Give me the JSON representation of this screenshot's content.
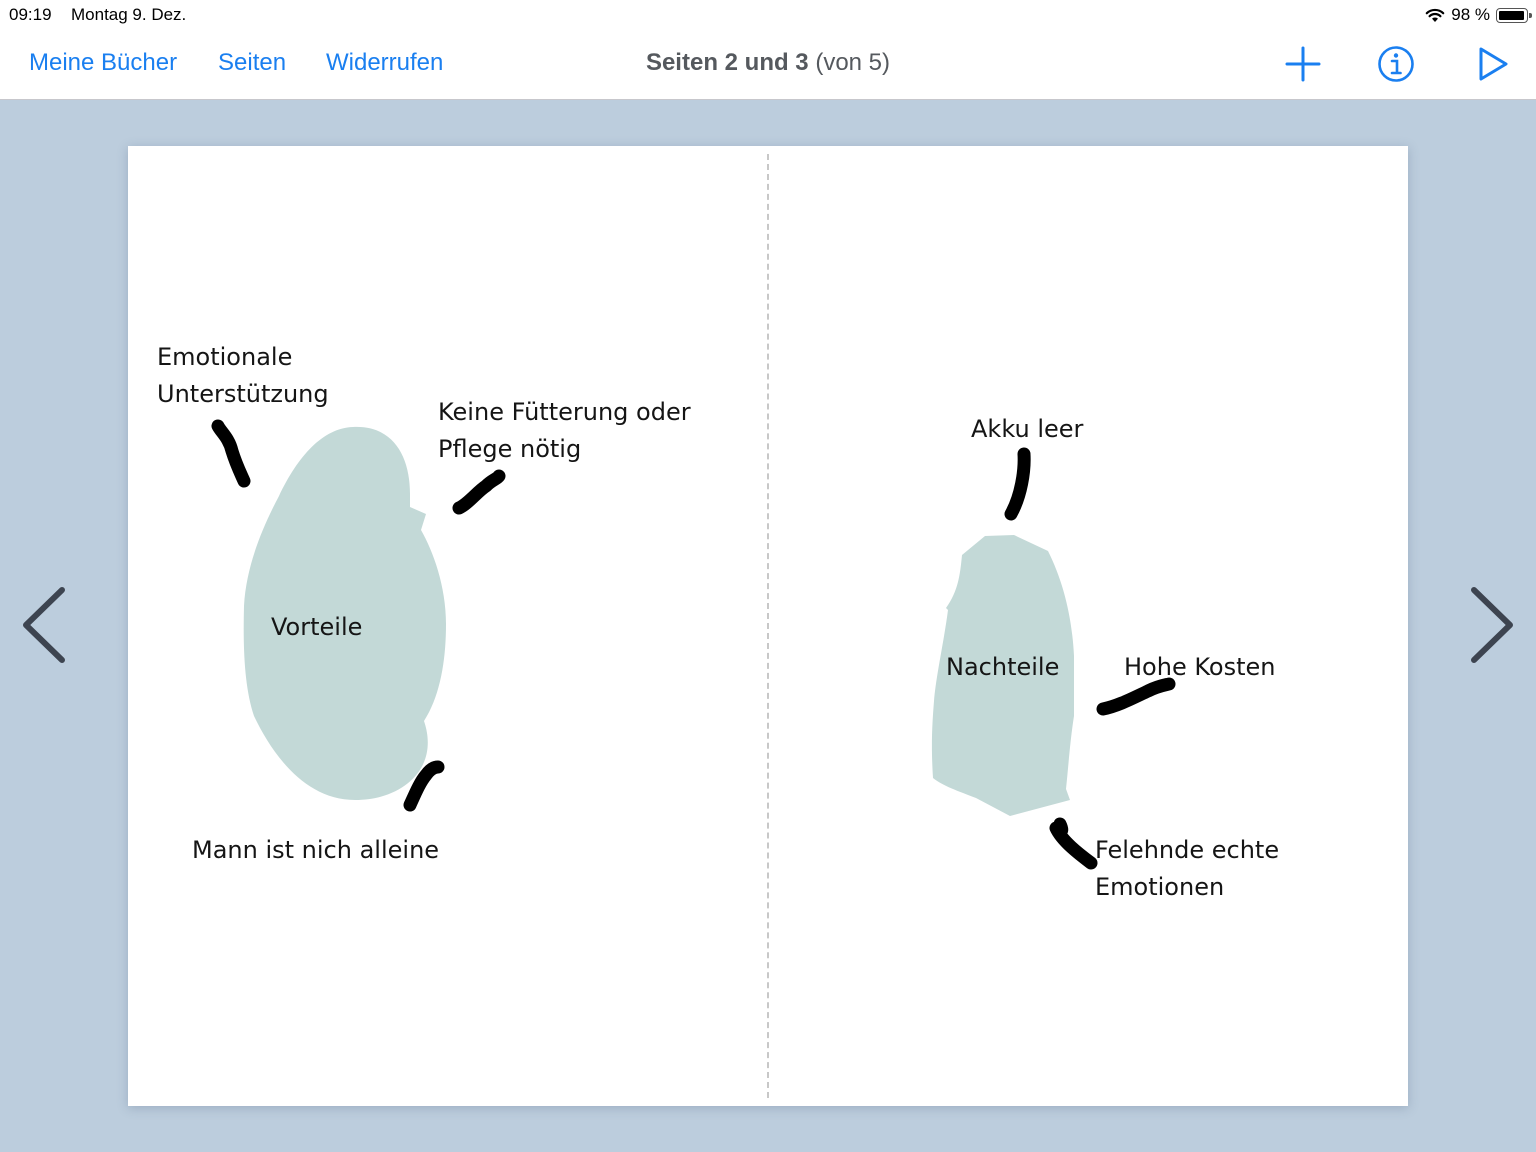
{
  "status": {
    "time": "09:19",
    "date": "Montag 9. Dez.",
    "battery": "98 %",
    "battery_level": 0.98
  },
  "nav": {
    "my_books": "Meine Bücher",
    "pages": "Seiten",
    "undo": "Widerrufen",
    "title_main": "Seiten 2 und 3",
    "title_sub": "(von 5)",
    "icons": [
      "plus-icon",
      "info-icon",
      "play-icon"
    ]
  },
  "paging": {
    "prev_icon": "chevron-left-icon",
    "next_icon": "chevron-right-icon"
  },
  "page_left": {
    "shape_label": "Vorteile",
    "notes": [
      "Emotionale",
      "Unterstützung",
      "Keine Fütterung oder",
      "Pflege nötig",
      "Mann ist nich alleine"
    ]
  },
  "page_right": {
    "shape_label": "Nachteile",
    "notes": [
      "Akku leer",
      "Hohe Kosten",
      "Felehnde echte",
      "Emotionen"
    ]
  },
  "colors": {
    "accent": "#1a7ff0",
    "background": "#bccddd",
    "shape_fill": "#c3d9d7",
    "ink": "#000000",
    "arrow": "#3d4450"
  }
}
